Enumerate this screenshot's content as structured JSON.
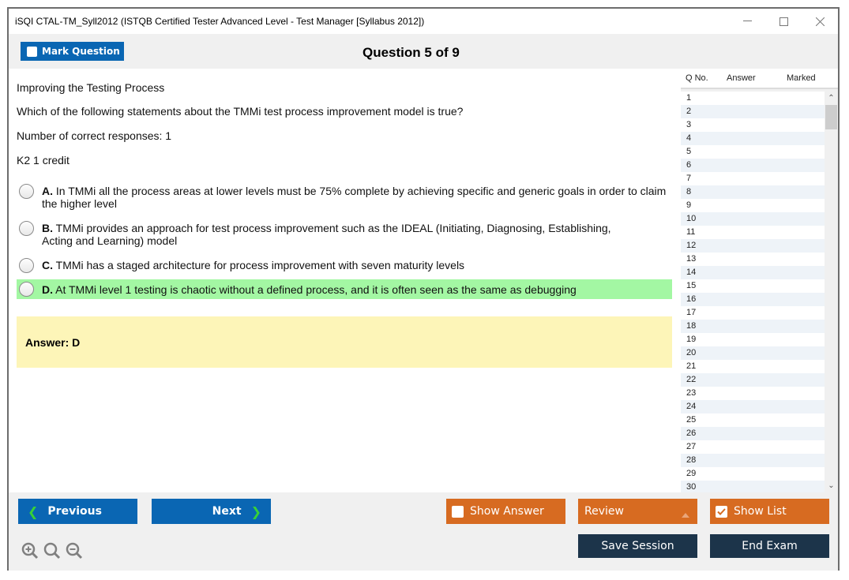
{
  "window": {
    "title": "iSQI CTAL-TM_Syll2012 (ISTQB Certified Tester Advanced Level - Test Manager [Syllabus 2012])",
    "controls": [
      "minimize-icon",
      "maximize-icon",
      "close-icon"
    ]
  },
  "header": {
    "mark_question_label": "Mark Question",
    "mark_question_checked": false,
    "question_title": "Question 5 of 9"
  },
  "question": {
    "topic": "Improving the Testing Process",
    "text": "Which of the following statements about the TMMi test process improvement model is true?",
    "correct_count": "Number of correct responses: 1",
    "credit": "K2 1 credit",
    "options": [
      {
        "letter": "A.",
        "text": "In TMMi all the process areas at lower levels must be 75% complete by achieving specific and generic goals in order to claim the higher level",
        "selected": false,
        "correct": false
      },
      {
        "letter": "B.",
        "text": "TMMi provides an approach for test process improvement such as the IDEAL (Initiating, Diagnosing, Establishing, Acting and Learning) model",
        "selected": false,
        "correct": false
      },
      {
        "letter": "C.",
        "text": "TMMi has a staged architecture for process improvement with seven maturity levels",
        "selected": false,
        "correct": false
      },
      {
        "letter": "D.",
        "text": "At TMMi level 1 testing is chaotic without a defined process, and it is often seen as the same as debugging",
        "selected": false,
        "correct": true
      }
    ],
    "answer_text": "Answer: D"
  },
  "question_list": {
    "headers": {
      "qno": "Q No.",
      "answer": "Answer",
      "marked": "Marked"
    },
    "rows": [
      "1",
      "2",
      "3",
      "4",
      "5",
      "6",
      "7",
      "8",
      "9",
      "10",
      "11",
      "12",
      "13",
      "14",
      "15",
      "16",
      "17",
      "18",
      "19",
      "20",
      "21",
      "22",
      "23",
      "24",
      "25",
      "26",
      "27",
      "28",
      "29",
      "30"
    ]
  },
  "footer": {
    "previous_label": "Previous",
    "next_label": "Next",
    "show_answer_label": "Show Answer",
    "show_answer_checked": false,
    "review_label": "Review",
    "show_list_label": "Show List",
    "show_list_checked": true,
    "save_session_label": "Save Session",
    "end_exam_label": "End Exam",
    "zoom_icons": [
      "zoom-in-icon",
      "zoom-reset-icon",
      "zoom-out-icon"
    ]
  },
  "colors": {
    "primary_blue": "#0a66b3",
    "orange": "#d76b21",
    "navy": "#1c344a",
    "correct_green": "#a3f7a3",
    "answer_yellow": "#fdf5b8"
  }
}
